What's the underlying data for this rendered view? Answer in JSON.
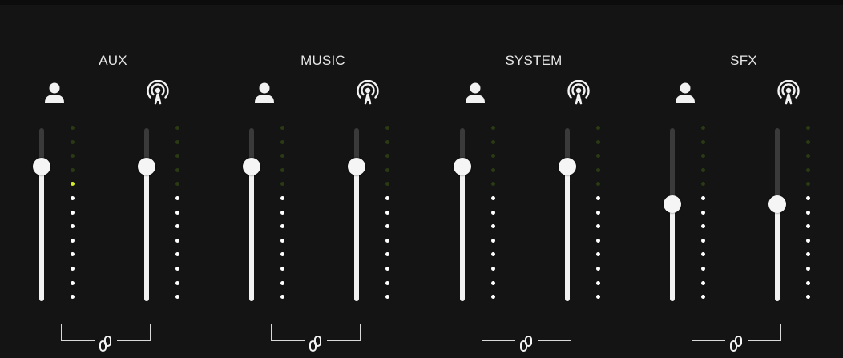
{
  "colors": {
    "background": "#141414",
    "meter_active": "#ffffff",
    "meter_peak": "#d7ea2a",
    "meter_off_green": "#2a3a12",
    "meter_off_grey": "#3a3a3a",
    "fader_fill": "#f2f2f2"
  },
  "groups": [
    {
      "title": "AUX",
      "icons": [
        "user-icon",
        "broadcast-icon"
      ],
      "faders": [
        {
          "role": "local",
          "level": 0.78,
          "meter_lit": 8,
          "meter_peak": true
        },
        {
          "role": "broadcast",
          "level": 0.78,
          "meter_lit": 8,
          "meter_peak": false
        }
      ],
      "linked": true
    },
    {
      "title": "MUSIC",
      "icons": [
        "user-icon",
        "broadcast-icon"
      ],
      "faders": [
        {
          "role": "local",
          "level": 0.78,
          "meter_lit": 8,
          "meter_peak": false
        },
        {
          "role": "broadcast",
          "level": 0.78,
          "meter_lit": 8,
          "meter_peak": false
        }
      ],
      "linked": true
    },
    {
      "title": "SYSTEM",
      "icons": [
        "user-icon",
        "broadcast-icon"
      ],
      "faders": [
        {
          "role": "local",
          "level": 0.78,
          "meter_lit": 8,
          "meter_peak": false
        },
        {
          "role": "broadcast",
          "level": 0.78,
          "meter_lit": 8,
          "meter_peak": false
        }
      ],
      "linked": true
    },
    {
      "title": "SFX",
      "icons": [
        "user-icon",
        "broadcast-icon"
      ],
      "faders": [
        {
          "role": "local",
          "level": 0.56,
          "meter_lit": 8,
          "meter_peak": false
        },
        {
          "role": "broadcast",
          "level": 0.56,
          "meter_lit": 8,
          "meter_peak": false
        }
      ],
      "linked": true
    }
  ]
}
